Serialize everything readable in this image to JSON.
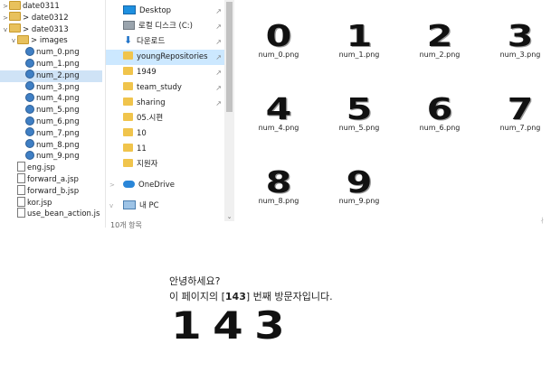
{
  "tree": {
    "items": [
      {
        "label": "date0311",
        "kind": "folder",
        "twisty": ">",
        "indent": 0
      },
      {
        "label": "> date0312",
        "kind": "folder",
        "twisty": ">",
        "indent": 0
      },
      {
        "label": "> date0313",
        "kind": "folder",
        "twisty": "v",
        "indent": 0
      },
      {
        "label": "> images",
        "kind": "folder",
        "twisty": "v",
        "indent": 1
      },
      {
        "label": "num_0.png",
        "kind": "globe",
        "indent": 2
      },
      {
        "label": "num_1.png",
        "kind": "globe",
        "indent": 2
      },
      {
        "label": "num_2.png",
        "kind": "globe",
        "indent": 2,
        "selected": true
      },
      {
        "label": "num_3.png",
        "kind": "globe",
        "indent": 2
      },
      {
        "label": "num_4.png",
        "kind": "globe",
        "indent": 2
      },
      {
        "label": "num_5.png",
        "kind": "globe",
        "indent": 2
      },
      {
        "label": "num_6.png",
        "kind": "globe",
        "indent": 2
      },
      {
        "label": "num_7.png",
        "kind": "globe",
        "indent": 2
      },
      {
        "label": "num_8.png",
        "kind": "globe",
        "indent": 2
      },
      {
        "label": "num_9.png",
        "kind": "globe",
        "indent": 2
      },
      {
        "label": "eng.jsp",
        "kind": "jsp",
        "indent": 1
      },
      {
        "label": "forward_a.jsp",
        "kind": "jsp",
        "indent": 1
      },
      {
        "label": "forward_b.jsp",
        "kind": "jsp",
        "indent": 1
      },
      {
        "label": "kor.jsp",
        "kind": "jsp",
        "indent": 1
      },
      {
        "label": "use_bean_action.js",
        "kind": "jsp",
        "indent": 1
      }
    ]
  },
  "nav": {
    "items": [
      {
        "label": "Desktop",
        "icon": "desk",
        "pinned": true
      },
      {
        "label": "로컬 디스크 (C:)",
        "icon": "disk",
        "pinned": true
      },
      {
        "label": "다운로드",
        "icon": "down",
        "pinned": true
      },
      {
        "label": "youngRepositories",
        "icon": "folder",
        "pinned": true,
        "selected": true
      },
      {
        "label": "1949",
        "icon": "folder",
        "pinned": true
      },
      {
        "label": "team_study",
        "icon": "folder",
        "pinned": true
      },
      {
        "label": "sharing",
        "icon": "folder",
        "pinned": true
      },
      {
        "label": "05.시편",
        "icon": "folder"
      },
      {
        "label": "10",
        "icon": "folder"
      },
      {
        "label": "11",
        "icon": "folder"
      },
      {
        "label": "지원자",
        "icon": "folder"
      },
      {
        "label": "OneDrive",
        "icon": "cloud",
        "expander": ">",
        "gap": true
      },
      {
        "label": "내 PC",
        "icon": "pc",
        "expander": "v",
        "gap": true
      }
    ],
    "status": "10개 항목"
  },
  "files": [
    {
      "glyph": "0",
      "name": "num_0.png"
    },
    {
      "glyph": "1",
      "name": "num_1.png"
    },
    {
      "glyph": "2",
      "name": "num_2.png"
    },
    {
      "glyph": "3",
      "name": "num_3.png"
    },
    {
      "glyph": "4",
      "name": "num_4.png"
    },
    {
      "glyph": "5",
      "name": "num_5.png"
    },
    {
      "glyph": "6",
      "name": "num_6.png"
    },
    {
      "glyph": "7",
      "name": "num_7.png"
    },
    {
      "glyph": "8",
      "name": "num_8.png"
    },
    {
      "glyph": "9",
      "name": "num_9.png"
    }
  ],
  "page": {
    "greeting": "안녕하세요?",
    "visit_prefix": "이 페이지의 [",
    "visit_count": "143",
    "visit_suffix": "] 번째 방문자입니다.",
    "digits": [
      "1",
      "4",
      "3"
    ]
  }
}
